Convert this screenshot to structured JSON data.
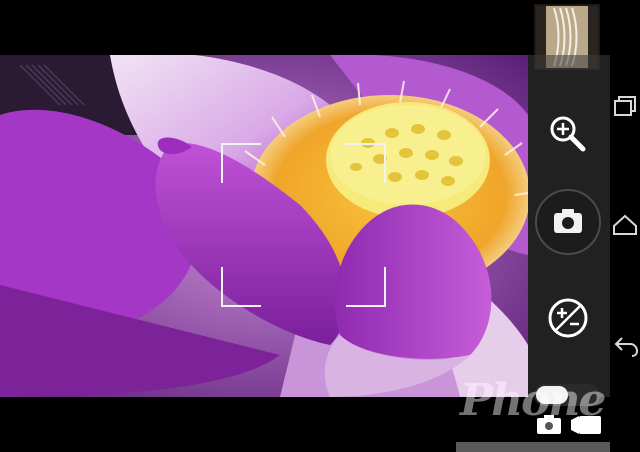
{
  "app": {
    "name": "Camera"
  },
  "watermark": {
    "text": "Phone"
  },
  "icons": {
    "zoom": "zoom-in-magnifier-icon",
    "shutter": "camera-shutter-icon",
    "exposure": "exposure-compensation-icon",
    "mode_photo": "camera-mode-icon",
    "mode_video": "video-mode-icon",
    "recents": "recent-apps-icon",
    "home": "home-icon",
    "back": "back-icon"
  },
  "colors": {
    "petal": "#b43ec8",
    "petal_light": "#e7c9ef",
    "stamen": "#f2b52a",
    "pod": "#f6ec7e",
    "controls_bg": "#3c3c3c"
  }
}
